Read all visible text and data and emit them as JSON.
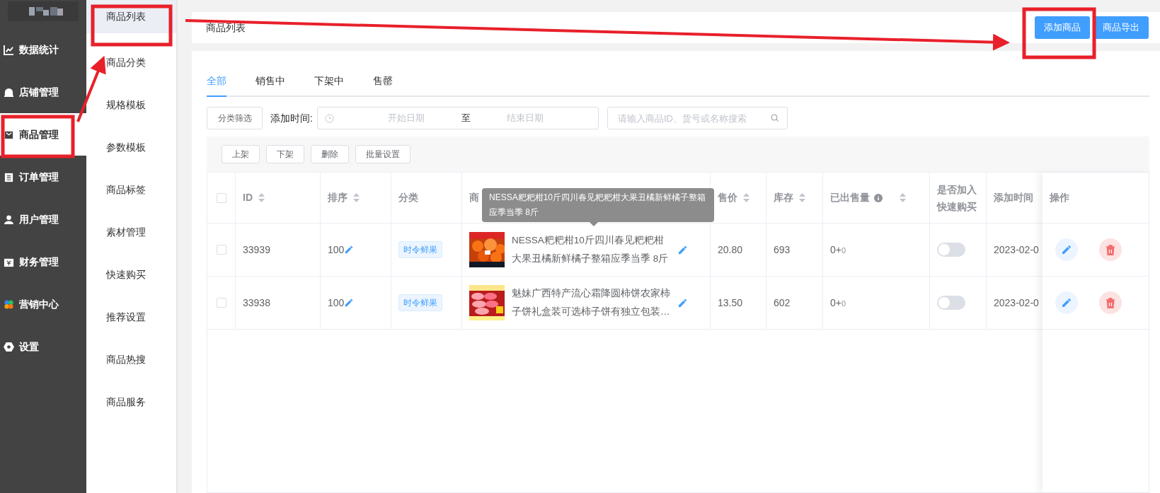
{
  "sidebar": {
    "items": [
      {
        "label": "数据统计",
        "selected": false
      },
      {
        "label": "店铺管理",
        "selected": false
      },
      {
        "label": "商品管理",
        "selected": true
      },
      {
        "label": "订单管理",
        "selected": false
      },
      {
        "label": "用户管理",
        "selected": false
      },
      {
        "label": "财务管理",
        "selected": false
      },
      {
        "label": "营销中心",
        "selected": false
      },
      {
        "label": "设置",
        "selected": false
      }
    ]
  },
  "submenu": {
    "items": [
      {
        "label": "商品列表",
        "selected": true
      },
      {
        "label": "商品分类",
        "selected": false
      },
      {
        "label": "规格模板",
        "selected": false
      },
      {
        "label": "参数模板",
        "selected": false
      },
      {
        "label": "商品标签",
        "selected": false
      },
      {
        "label": "素材管理",
        "selected": false
      },
      {
        "label": "快速购买",
        "selected": false
      },
      {
        "label": "推荐设置",
        "selected": false
      },
      {
        "label": "商品热搜",
        "selected": false
      },
      {
        "label": "商品服务",
        "selected": false
      }
    ]
  },
  "header": {
    "title": "商品列表",
    "buttons": [
      "添加商品",
      "商品导出"
    ]
  },
  "tabs": [
    {
      "label": "全部",
      "selected": true
    },
    {
      "label": "销售中",
      "selected": false
    },
    {
      "label": "下架中",
      "selected": false
    },
    {
      "label": "售罄",
      "selected": false
    }
  ],
  "filters": {
    "category_button": "分类筛选",
    "date_label": "添加时间:",
    "start_placeholder": "开始日期",
    "separator": "至",
    "end_placeholder": "结束日期",
    "search_placeholder": "请输入商品ID、货号或名称搜索"
  },
  "batch_buttons": [
    "上架",
    "下架",
    "删除",
    "批量设置"
  ],
  "table": {
    "select_all": {
      "checked": false
    },
    "columns": [
      {
        "label": "ID",
        "sortable": true,
        "info": false
      },
      {
        "label": "排序",
        "sortable": true,
        "info": false
      },
      {
        "label": "分类",
        "sortable": false,
        "info": false
      },
      {
        "label": "商",
        "sortable": false,
        "info": false
      },
      {
        "label": "售价",
        "sortable": true,
        "info": false
      },
      {
        "label": "库存",
        "sortable": true,
        "info": false
      },
      {
        "label": "已出售量",
        "sortable": true,
        "info": true
      },
      {
        "label": "是否加入快速购买",
        "sortable": false,
        "info": false
      },
      {
        "label": "添加时间",
        "sortable": false,
        "info": false
      },
      {
        "label": "操作",
        "sortable": false,
        "info": false
      }
    ],
    "rows": [
      {
        "checked": false,
        "id": "33939",
        "sort": "100",
        "category": "时令鲜果",
        "name": "NESSA粑粑柑10斤四川春见粑粑柑大果丑橘新鲜橘子整箱应季当季 8斤",
        "price": "20.80",
        "stock": "693",
        "sold": "0+",
        "sold_extra": "0",
        "quick_buy": {
          "on": false
        },
        "added": "2023-02-0"
      },
      {
        "checked": false,
        "id": "33938",
        "sort": "100",
        "category": "时令鲜果",
        "name": "魅妹广西特产流心霜降圆柿饼农家柿子饼礼盒装可选柿子饼有独立包装…",
        "price": "13.50",
        "stock": "602",
        "sold": "0+",
        "sold_extra": "0",
        "quick_buy": {
          "on": false
        },
        "added": "2023-02-0"
      }
    ]
  },
  "tooltip": "NESSA粑粑柑10斤四川春见粑粑柑大果丑橘新鲜橘子整箱应季当季 8斤"
}
